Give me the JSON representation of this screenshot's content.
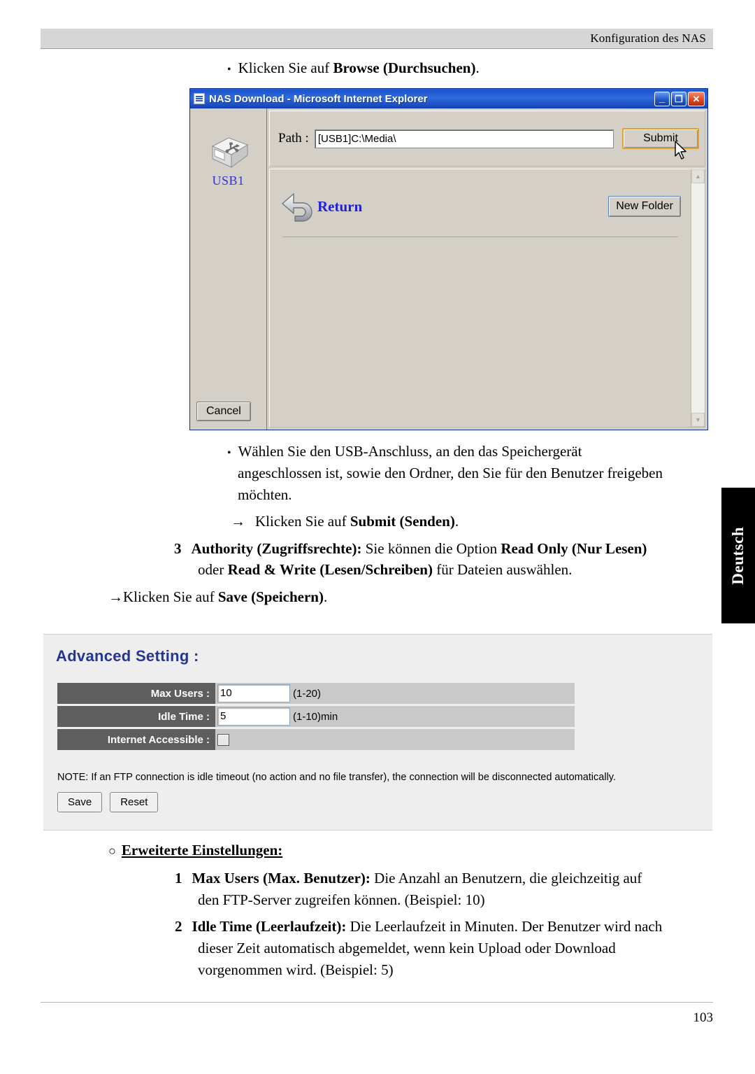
{
  "header": {
    "running_head": "Konfiguration des NAS"
  },
  "intro": {
    "bullet": "•",
    "text_plain": "Klicken Sie auf ",
    "text_bold": "Browse (Durchsuchen)",
    "text_end": "."
  },
  "ie_window": {
    "title": "NAS Download - Microsoft Internet Explorer",
    "favicon": "ie-page-icon",
    "window_buttons": {
      "minimize": "_",
      "maximize": "❐",
      "close": "✕"
    },
    "left_pane": {
      "device_icon": "usb-port-icon",
      "device_label": "USB1",
      "cancel_label": "Cancel"
    },
    "path_row": {
      "label": "Path :",
      "value": "[USB1]C:\\Media\\",
      "submit_label": "Submit",
      "cursor": "mouse-pointer-icon"
    },
    "file_pane": {
      "return_icon": "back-arrow-icon",
      "return_label": "Return",
      "new_folder_label": "New Folder"
    },
    "scrollbar": {
      "up": "▲",
      "down": "▼"
    }
  },
  "steps": {
    "bullet2": {
      "marker": "•",
      "line1": "Wählen Sie den USB-Anschluss, an den das Speichergerät",
      "line2": "angeschlossen ist, sowie den Ordner, den Sie für den Benutzer freigeben",
      "line3": "möchten."
    },
    "arrow_submit": {
      "marker": "→",
      "plain": "Klicken Sie auf ",
      "bold": "Submit (Senden)",
      "end": "."
    },
    "item3": {
      "number": "3",
      "bold1": "Authority (Zugriffsrechte):",
      "plain1": " Sie können die Option ",
      "bold2": "Read Only (Nur Lesen)",
      "line2_plain1": "oder ",
      "line2_bold": "Read & Write (Lesen/Schreiben)",
      "line2_plain2": " für Dateien auswählen."
    },
    "arrow_save": {
      "marker": "→",
      "plain": "Klicken Sie auf ",
      "bold": "Save (Speichern)",
      "end": "."
    }
  },
  "advanced_setting": {
    "title": "Advanced Setting :",
    "rows": [
      {
        "label": "Max Users :",
        "value": "10",
        "hint": "(1-20)",
        "type": "text"
      },
      {
        "label": "Idle Time :",
        "value": "5",
        "hint": "(1-10)min",
        "type": "text"
      },
      {
        "label": "Internet Accessible :",
        "value": "",
        "hint": "",
        "type": "checkbox"
      }
    ],
    "note": "NOTE: If an FTP connection is idle timeout (no action and no file transfer), the connection will be disconnected automatically.",
    "save_label": "Save",
    "reset_label": "Reset"
  },
  "explanations": {
    "heading_marker": "○",
    "heading": "Erweiterte Einstellungen:",
    "item1": {
      "number": "1",
      "bold": "Max Users (Max. Benutzer):",
      "line1_plain": " Die Anzahl an Benutzern, die gleichzeitig auf",
      "line2": "den FTP-Server zugreifen können. (Beispiel: 10)"
    },
    "item2": {
      "number": "2",
      "bold": "Idle Time (Leerlaufzeit):",
      "line1_plain": " Die Leerlaufzeit in Minuten. Der Benutzer wird nach",
      "line2": "dieser Zeit automatisch abgemeldet, wenn kein Upload oder Download",
      "line3": "vorgenommen wird. (Beispiel: 5)"
    }
  },
  "language_tab": {
    "label": "Deutsch"
  },
  "footer": {
    "page_number": "103"
  },
  "colors": {
    "header_band": "#d6d6d6",
    "titlebar_blue": "#1c55cf",
    "link_blue": "#2020dd",
    "adv_title_blue": "#25368c",
    "adv_label_gray": "#5e5e5e",
    "adv_value_gray": "#c9c9c9",
    "panel_bg": "#eeeeee",
    "submit_focus": "#e8a020"
  }
}
